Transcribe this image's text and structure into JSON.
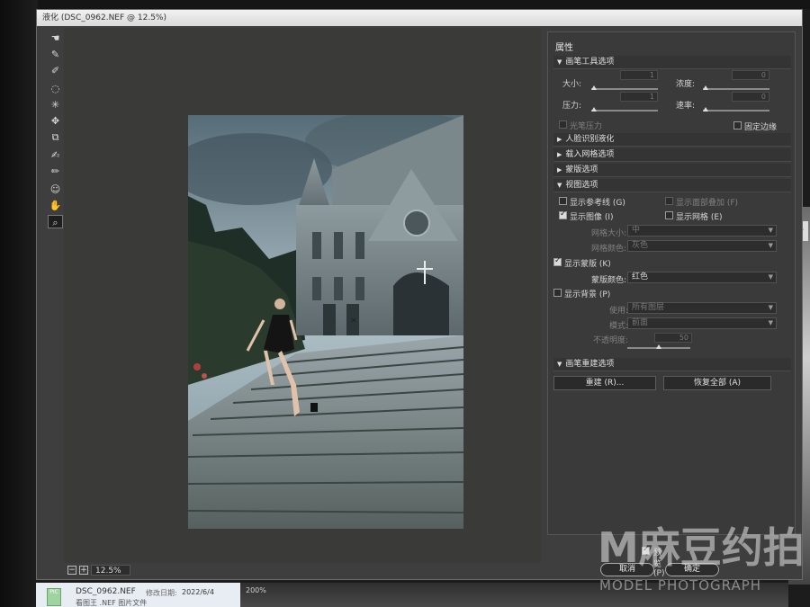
{
  "window": {
    "title": "液化 (DSC_0962.NEF @ 12.5%)"
  },
  "canvas": {
    "zoom": "12.5%",
    "zoom_out": "−",
    "zoom_in": "+"
  },
  "panel": {
    "header": "属性",
    "brush_tool": {
      "title": "画笔工具选项",
      "size_label": "大小:",
      "size_value": "1",
      "density_label": "浓度:",
      "density_value": "0",
      "pressure_label": "压力:",
      "pressure_value": "1",
      "rate_label": "速率:",
      "rate_value": "0",
      "stylus_label": "光笔压力",
      "pin_edges_label": "固定边缘"
    },
    "face_aware": {
      "title": "人脸识别液化"
    },
    "load_mesh": {
      "title": "载入网格选项"
    },
    "mask_options": {
      "title": "蒙版选项"
    },
    "view_options": {
      "title": "视图选项",
      "show_guides": "显示参考线 (G)",
      "show_face_overlay": "显示面部叠加 (F)",
      "show_image": "显示图像 (I)",
      "show_mesh": "显示网格 (E)",
      "mesh_size_label": "网格大小:",
      "mesh_size_value": "中",
      "mesh_color_label": "网格颜色:",
      "mesh_color_value": "灰色"
    },
    "show_mask": {
      "label": "显示蒙版 (K)",
      "mask_color_label": "蒙版颜色:",
      "mask_color_value": "红色"
    },
    "show_backdrop": {
      "label": "显示背景 (P)",
      "use_label": "使用:",
      "use_value": "所有图层",
      "mode_label": "模式:",
      "mode_value": "前面",
      "opacity_label": "不透明度:",
      "opacity_value": "50"
    },
    "reconstruct": {
      "title": "画笔重建选项",
      "rebuild_button": "重建 (R)...",
      "restore_all_button": "恢复全部 (A)"
    }
  },
  "footer": {
    "preview_label": "预览 (P)",
    "cancel_button": "取消",
    "ok_button": "确定"
  },
  "filebar": {
    "file_name": "DSC_0962.NEF",
    "file_type": "看图王 .NEF 图片文件",
    "date_label": "修改日期:",
    "date_value": "2022/6/4",
    "status_zoom": "200%",
    "icon_label": "PIC"
  },
  "watermark": {
    "logo": "M麻豆约拍",
    "text": "MODEL PHOTOGRAPH"
  },
  "side_chip": "音",
  "colors": {
    "panel_bg": "#3a3a3a",
    "canvas_bg": "#3a3a38",
    "mask_red": "#c23a3a"
  }
}
